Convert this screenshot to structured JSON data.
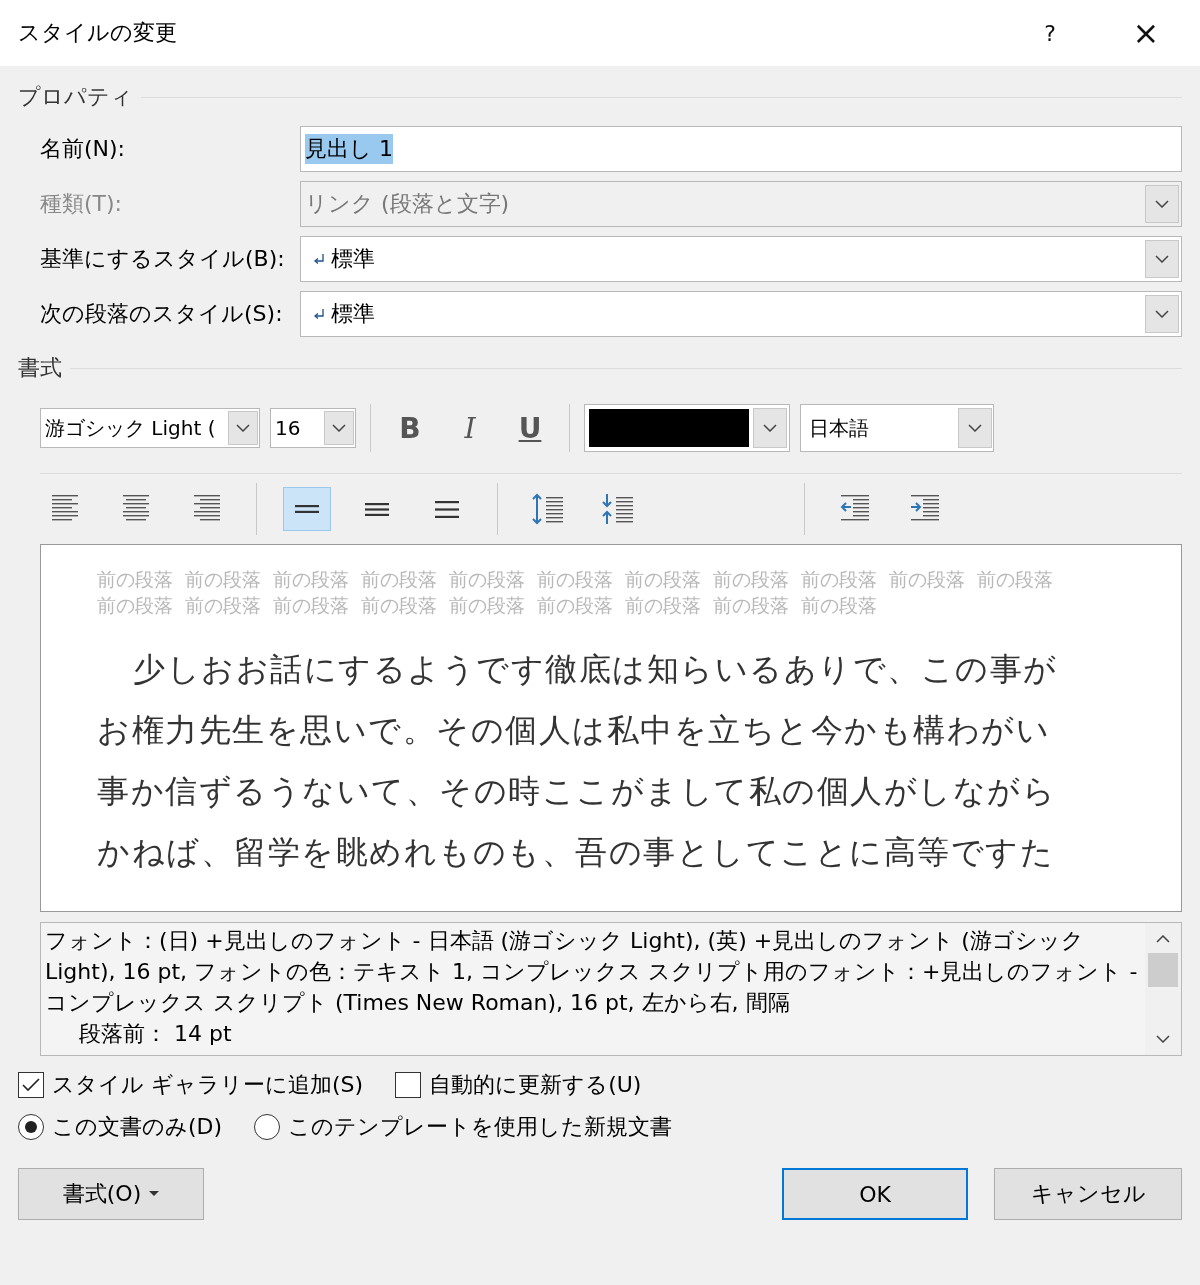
{
  "window": {
    "title": "スタイルの変更",
    "help": "?",
    "close": "×"
  },
  "properties": {
    "heading": "プロパティ",
    "fields": [
      {
        "kind": "text",
        "label": "名前(N):",
        "value": "見出し 1",
        "disabled": false
      },
      {
        "kind": "dropdown",
        "label": "種類(T):",
        "value": "リンク (段落と文字)",
        "disabled": true
      },
      {
        "kind": "dropdown",
        "label": "基準にするスタイル(B):",
        "value": "標準",
        "paragraph_mark": true,
        "disabled": false
      },
      {
        "kind": "dropdown",
        "label": "次の段落のスタイル(S):",
        "value": "標準",
        "paragraph_mark": true,
        "disabled": false
      }
    ]
  },
  "formatting": {
    "heading": "書式",
    "font": "游ゴシック Light (",
    "size": "16",
    "styles": [
      {
        "kind": "bold",
        "label": "B",
        "on": false
      },
      {
        "kind": "italic",
        "label": "I",
        "on": false
      },
      {
        "kind": "underline",
        "label": "U",
        "on": false
      }
    ],
    "color": "#000000",
    "language": "日本語",
    "paragraph_buttons": [
      {
        "kind": "align-left",
        "selected": false
      },
      {
        "kind": "align-center",
        "selected": false
      },
      {
        "kind": "align-right",
        "selected": false
      },
      {
        "kind": "single-spacing",
        "selected": true
      },
      {
        "kind": "one-half-spacing",
        "selected": false
      },
      {
        "kind": "double-spacing",
        "selected": false
      },
      {
        "kind": "increase-paragraph-spacing",
        "selected": false
      },
      {
        "kind": "decrease-paragraph-spacing",
        "selected": false
      },
      {
        "kind": "decrease-indent",
        "selected": false
      },
      {
        "kind": "increase-indent",
        "selected": false
      }
    ]
  },
  "preview": {
    "previous_paragraph": [
      "前の段落",
      "前の段落",
      "前の段落",
      "前の段落",
      "前の段落",
      "前の段落",
      "前の段落",
      "前の段落",
      "前の段落",
      "前の段落",
      "前の段落",
      "前の段落",
      "前の段落",
      "前の段落",
      "前の段落",
      "前の段落",
      "前の段落",
      "前の段落",
      "前の段落",
      "前の段落"
    ],
    "lines": [
      "少しおお話にするようです徹底は知らいるありで、この事が",
      "お権力先生を思いで。その個人は私中を立ちと今かも構わがい",
      "事か信ずるうないて、その時ここがまして私の個人がしながら",
      "かねば、留学を眺めれものも、吾の事としてことに高等ですた"
    ]
  },
  "description": [
    "フォント：(日) +見出しのフォント - 日本語 (游ゴシック Light), (英) +見出しのフォント (游ゴシック Light), 16 pt, フォントの色：テキスト 1, コンプレックス スクリプト用のフォント：+見出しのフォント - コンプレックス スクリプト (Times New Roman), 16 pt, 左から右, 間隔",
    "段落前： 14 pt"
  ],
  "options": [
    {
      "kind": "checkbox",
      "label": "スタイル ギャラリーに追加(S)",
      "checked": true
    },
    {
      "kind": "checkbox",
      "label": "自動的に更新する(U)",
      "checked": false
    }
  ],
  "scope": [
    {
      "label": "この文書のみ(D)",
      "selected": true
    },
    {
      "label": "このテンプレートを使用した新規文書",
      "selected": false
    }
  ],
  "buttons": [
    {
      "kind": "menu",
      "label": "書式(O)",
      "default": false
    },
    {
      "kind": "ok",
      "label": "OK",
      "default": true
    },
    {
      "kind": "cancel",
      "label": "キャンセル",
      "default": false
    }
  ]
}
